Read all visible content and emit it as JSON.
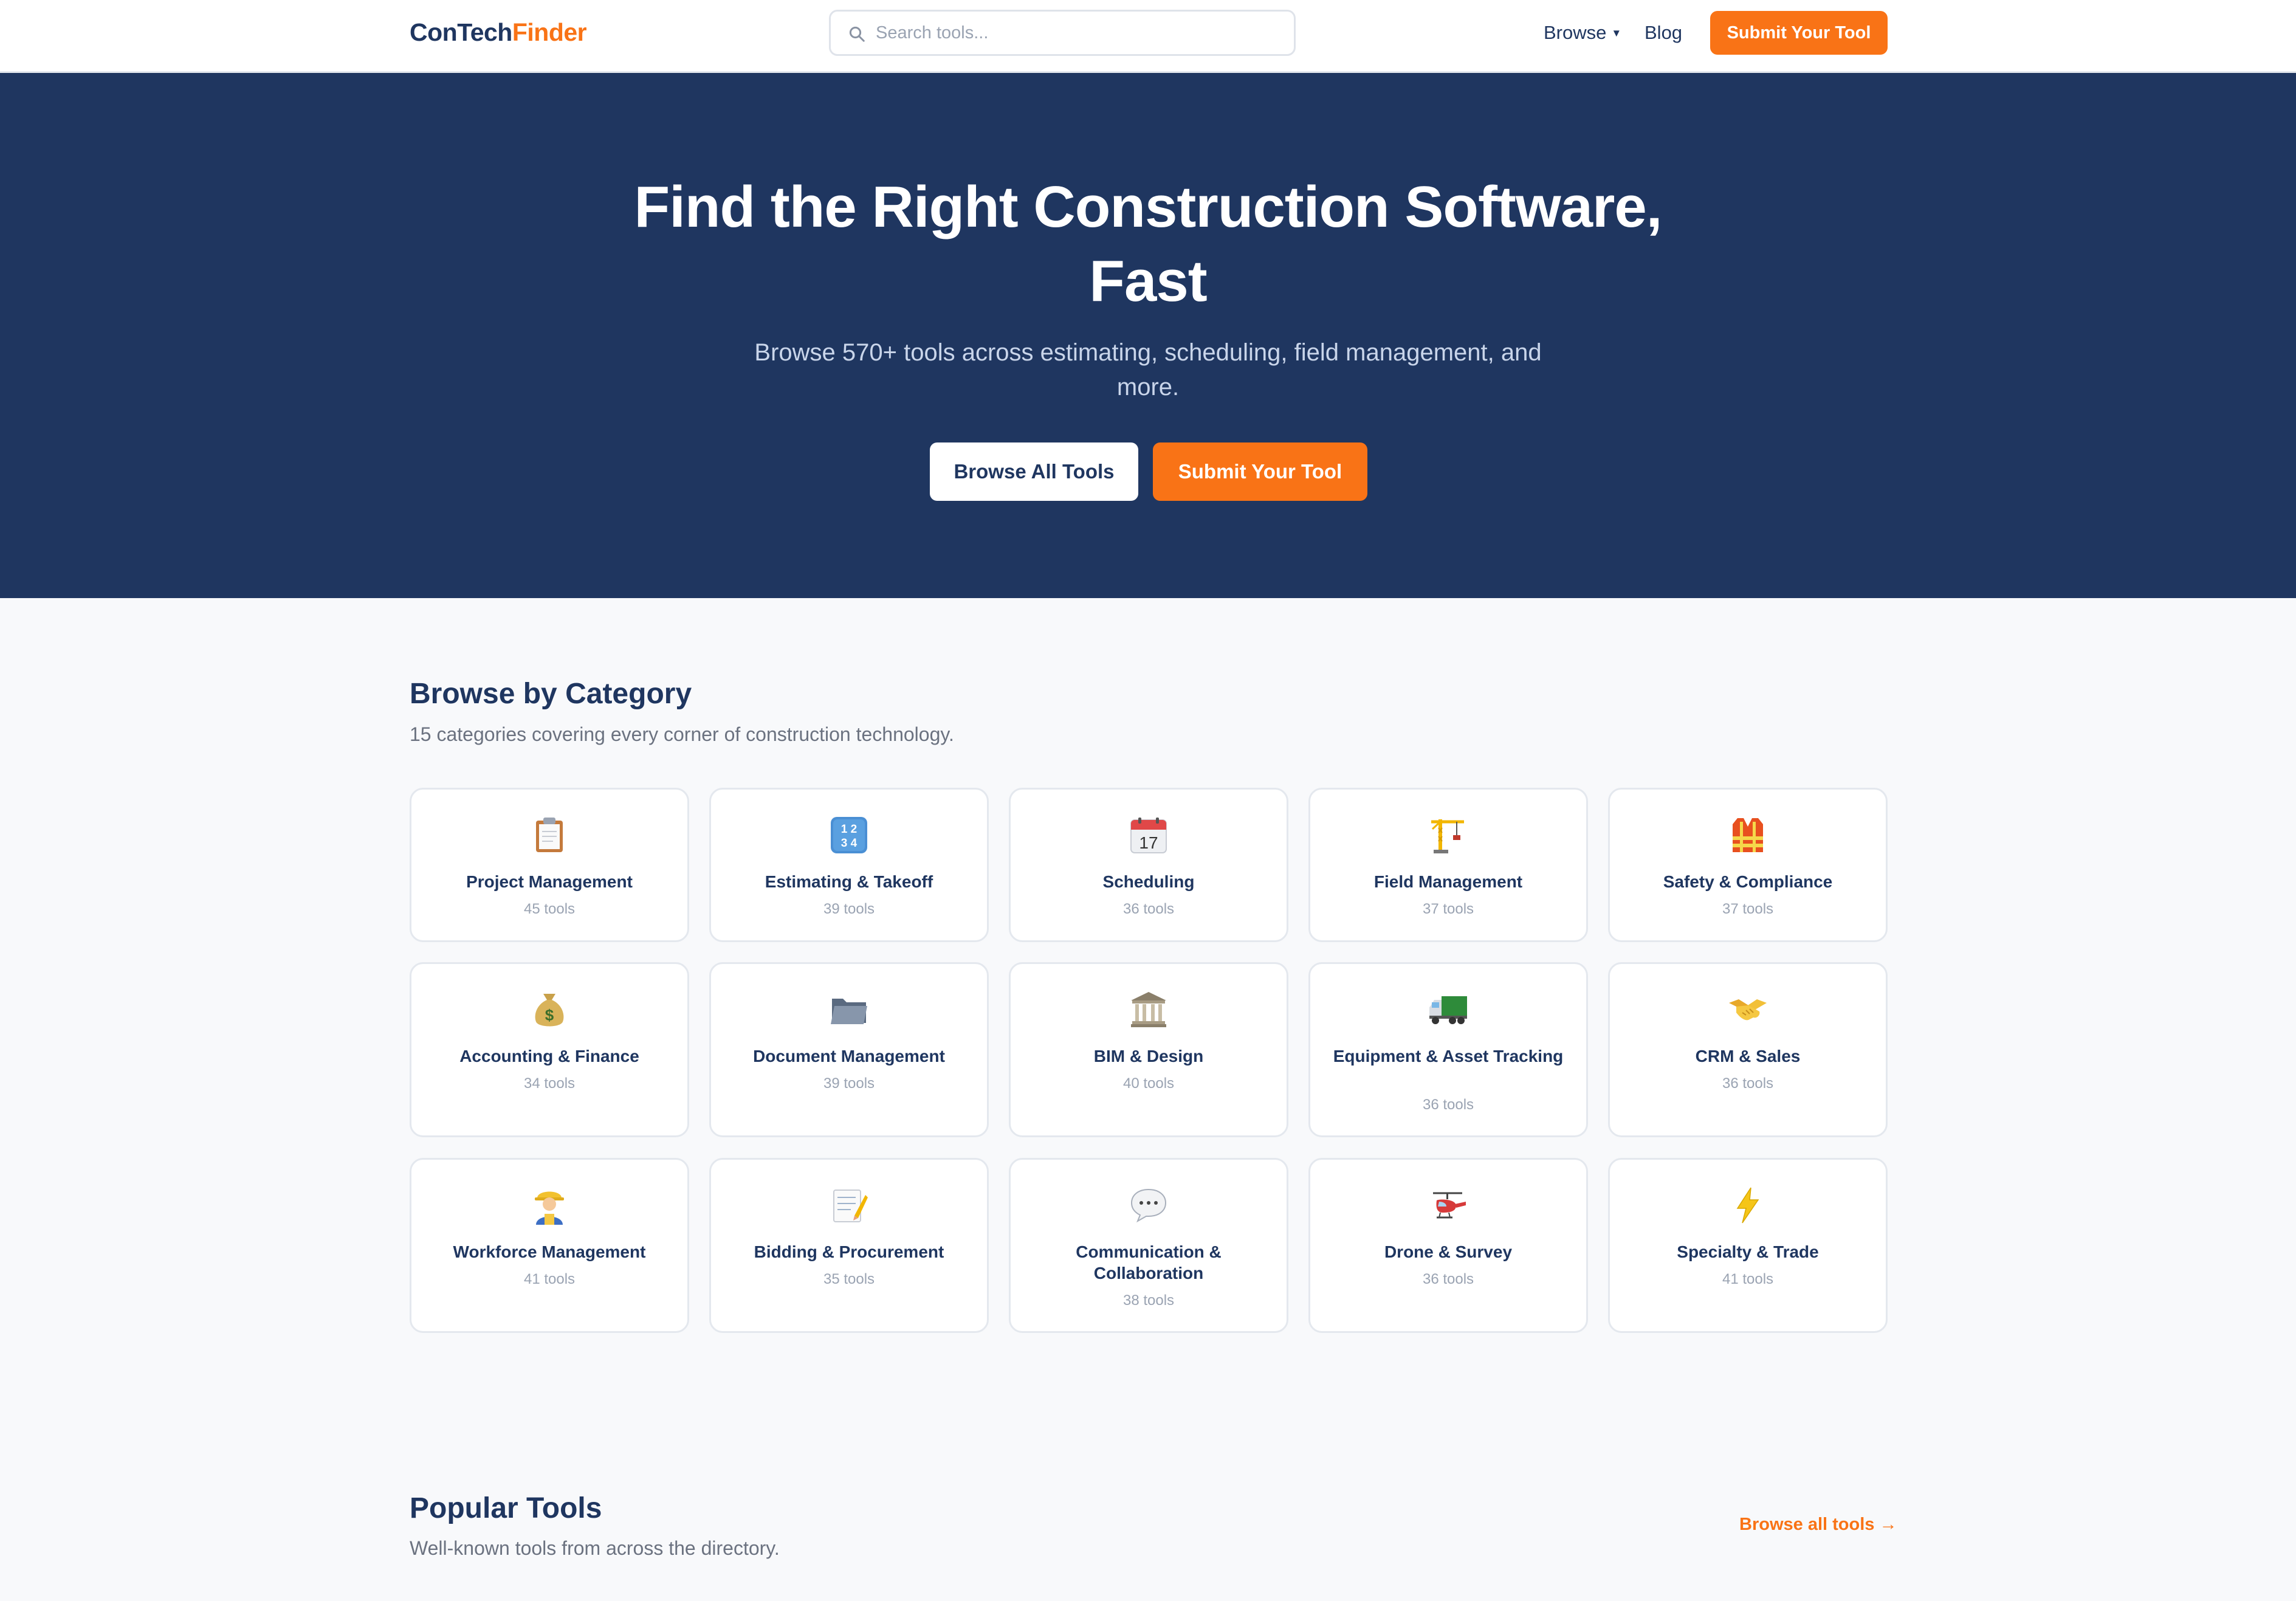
{
  "header": {
    "logo_part1": "ConTech",
    "logo_part2": "Finder",
    "search_placeholder": "Search tools...",
    "nav_browse": "Browse",
    "nav_blog": "Blog",
    "submit_label": "Submit Your Tool"
  },
  "hero": {
    "title": "Find the Right Construction Software, Fast",
    "subtitle": "Browse 570+ tools across estimating, scheduling, field management, and more.",
    "browse_all_label": "Browse All Tools",
    "submit_label": "Submit Your Tool"
  },
  "categories": {
    "title": "Browse by Category",
    "subtitle": "15 categories covering every corner of construction technology.",
    "items": [
      {
        "name": "Project Management",
        "count": "45 tools",
        "icon": "clipboard-icon"
      },
      {
        "name": "Estimating & Takeoff",
        "count": "39 tools",
        "icon": "numbers-icon"
      },
      {
        "name": "Scheduling",
        "count": "36 tools",
        "icon": "calendar-icon"
      },
      {
        "name": "Field Management",
        "count": "37 tools",
        "icon": "crane-icon"
      },
      {
        "name": "Safety & Compliance",
        "count": "37 tools",
        "icon": "safety-vest-icon"
      },
      {
        "name": "Accounting & Finance",
        "count": "34 tools",
        "icon": "money-bag-icon"
      },
      {
        "name": "Document Management",
        "count": "39 tools",
        "icon": "folder-icon"
      },
      {
        "name": "BIM & Design",
        "count": "40 tools",
        "icon": "classical-building-icon"
      },
      {
        "name": "Equipment & Asset Tracking",
        "count": "36 tools",
        "icon": "truck-icon"
      },
      {
        "name": "CRM & Sales",
        "count": "36 tools",
        "icon": "handshake-icon"
      },
      {
        "name": "Workforce Management",
        "count": "41 tools",
        "icon": "construction-worker-icon"
      },
      {
        "name": "Bidding & Procurement",
        "count": "35 tools",
        "icon": "memo-icon"
      },
      {
        "name": "Communication & Collaboration",
        "count": "38 tools",
        "icon": "speech-bubble-icon"
      },
      {
        "name": "Drone & Survey",
        "count": "36 tools",
        "icon": "helicopter-icon"
      },
      {
        "name": "Specialty & Trade",
        "count": "41 tools",
        "icon": "lightning-icon"
      }
    ]
  },
  "popular": {
    "title": "Popular Tools",
    "subtitle": "Well-known tools from across the directory.",
    "browse_link": "Browse all tools →"
  },
  "colors": {
    "navy": "#1f3660",
    "orange": "#f97316",
    "background": "#f8f9fb"
  }
}
